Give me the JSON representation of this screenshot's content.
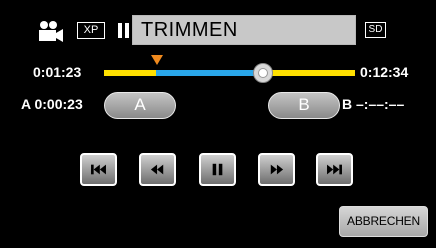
{
  "header": {
    "mode_icon": "video-camera-icon",
    "quality_badge": "XP",
    "state_icon": "pause-icon",
    "title": "TRIMMEN",
    "storage_badge": "SD"
  },
  "timeline": {
    "current_time": "0:01:23",
    "total_time": "0:12:34",
    "colors": {
      "selected": "#2aa7ea",
      "unselected": "#ffe000",
      "marker": "#f08a1e"
    }
  },
  "points": {
    "a_letter": "A",
    "a_time": "A 0:00:23",
    "a_button_label": "A",
    "b_button_label": "B",
    "b_time": "B  –:––:––"
  },
  "transport": [
    {
      "icon": "skip-to-start-icon"
    },
    {
      "icon": "rewind-icon"
    },
    {
      "icon": "pause-icon"
    },
    {
      "icon": "fast-forward-icon"
    },
    {
      "icon": "skip-to-end-icon"
    }
  ],
  "actions": {
    "cancel_label": "ABBRECHEN"
  }
}
